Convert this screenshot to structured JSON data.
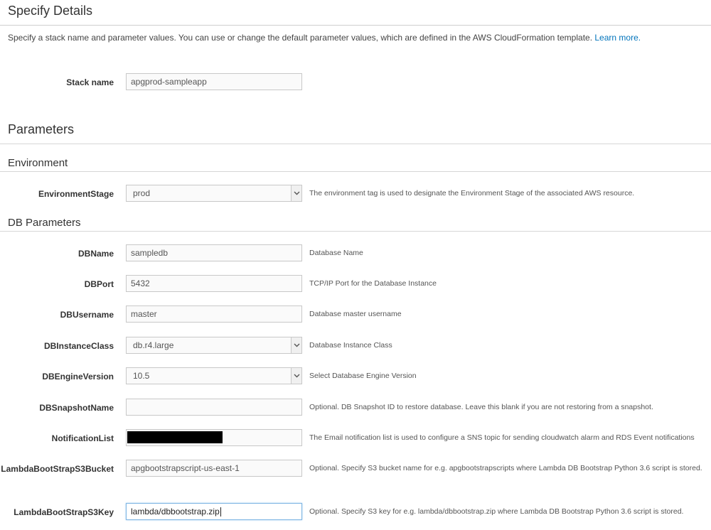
{
  "header": {
    "title": "Specify Details",
    "intro": "Specify a stack name and parameter values. You can use or change the default parameter values, which are defined in the AWS CloudFormation template.",
    "learn_more": "Learn more."
  },
  "stack": {
    "label": "Stack name",
    "value": "apgprod-sampleapp"
  },
  "parameters_title": "Parameters",
  "environment": {
    "title": "Environment",
    "stage": {
      "label": "EnvironmentStage",
      "value": "prod",
      "help": "The environment tag is used to designate the Environment Stage of the associated AWS resource."
    }
  },
  "db": {
    "title": "DB Parameters",
    "fields": [
      {
        "label": "DBName",
        "value": "sampledb",
        "help": "Database Name"
      },
      {
        "label": "DBPort",
        "value": "5432",
        "help": "TCP/IP Port for the Database Instance"
      },
      {
        "label": "DBUsername",
        "value": "master",
        "help": "Database master username"
      },
      {
        "label": "DBInstanceClass",
        "value": "db.r4.large",
        "help": "Database Instance Class"
      },
      {
        "label": "DBEngineVersion",
        "value": "10.5",
        "help": "Select Database Engine Version"
      },
      {
        "label": "DBSnapshotName",
        "value": "",
        "help": "Optional. DB Snapshot ID to restore database. Leave this blank if you are not restoring from a snapshot."
      },
      {
        "label": "NotificationList",
        "value": "",
        "help": "The Email notification list is used to configure a SNS topic for sending cloudwatch alarm and RDS Event notifications"
      },
      {
        "label": "LambdaBootStrapS3Bucket",
        "value": "apgbootstrapscript-us-east-1",
        "help": "Optional. Specify S3 bucket name for e.g. apgbootstrapscripts where Lambda DB Bootstrap Python 3.6 script is stored."
      },
      {
        "label": "LambdaBootStrapS3Key",
        "value": "lambda/dbbootstrap.zip",
        "help": "Optional. Specify S3 key for e.g. lambda/dbbootstrap.zip where Lambda DB Bootstrap Python 3.6 script is stored."
      }
    ]
  }
}
